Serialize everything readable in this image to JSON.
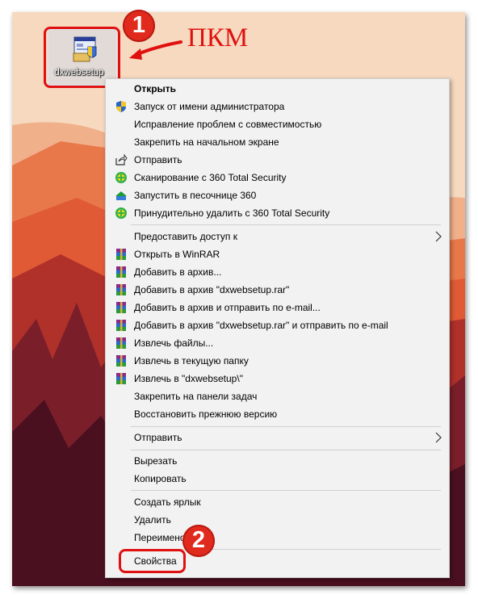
{
  "desktop": {
    "file_name": "dxwebsetup",
    "annotation_text": "ПКМ",
    "step1": "1",
    "step2": "2",
    "highlight_color": "#e01010"
  },
  "menu": {
    "items": [
      {
        "label": "Открыть",
        "icon": "none"
      },
      {
        "label": "Запуск от имени администратора",
        "icon": "uac-shield-icon"
      },
      {
        "label": "Исправление проблем с совместимостью",
        "icon": "none"
      },
      {
        "label": "Закрепить на начальном экране",
        "icon": "none"
      },
      {
        "label": "Отправить",
        "icon": "share-icon"
      },
      {
        "label": "Сканирование с 360 Total Security",
        "icon": "360-icon"
      },
      {
        "label": "Запустить в песочнице 360",
        "icon": "sandbox-icon"
      },
      {
        "label": "Принудительно удалить с  360 Total Security",
        "icon": "360-icon"
      },
      {
        "label": "Предоставить доступ к",
        "icon": "none"
      },
      {
        "label": "Открыть в WinRAR",
        "icon": "winrar-icon"
      },
      {
        "label": "Добавить в архив...",
        "icon": "winrar-icon"
      },
      {
        "label": "Добавить в архив \"dxwebsetup.rar\"",
        "icon": "winrar-icon"
      },
      {
        "label": "Добавить в архив и отправить по e-mail...",
        "icon": "winrar-icon"
      },
      {
        "label": "Добавить в архив \"dxwebsetup.rar\" и отправить по e-mail",
        "icon": "winrar-icon"
      },
      {
        "label": "Извлечь файлы...",
        "icon": "winrar-icon"
      },
      {
        "label": "Извлечь в текущую папку",
        "icon": "winrar-icon"
      },
      {
        "label": "Извлечь в \"dxwebsetup\\\"",
        "icon": "winrar-icon"
      },
      {
        "label": "Закрепить на панели задач",
        "icon": "none"
      },
      {
        "label": "Восстановить прежнюю версию",
        "icon": "none"
      },
      {
        "label": "Отправить",
        "icon": "none"
      },
      {
        "label": "Вырезать",
        "icon": "none"
      },
      {
        "label": "Копировать",
        "icon": "none"
      },
      {
        "label": "Создать ярлык",
        "icon": "none"
      },
      {
        "label": "Удалить",
        "icon": "none"
      },
      {
        "label": "Переименовать",
        "icon": "none"
      },
      {
        "label": "Свойства",
        "icon": "none"
      }
    ]
  }
}
